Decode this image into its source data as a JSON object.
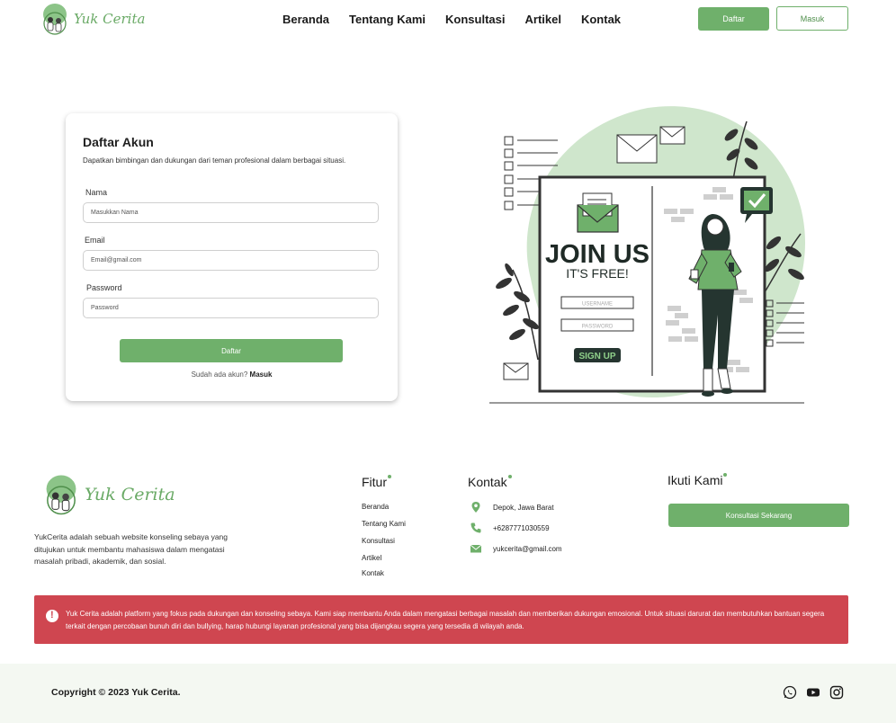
{
  "brand": {
    "name": "Yuk Cerita"
  },
  "nav": {
    "items": [
      "Beranda",
      "Tentang Kami",
      "Konsultasi",
      "Artikel",
      "Kontak"
    ],
    "daftar_label": "Daftar",
    "masuk_label": "Masuk"
  },
  "form": {
    "title": "Daftar Akun",
    "subtitle": "Dapatkan bimbingan dan dukungan dari teman profesional dalam berbagai situasi.",
    "fields": [
      {
        "label": "Nama",
        "placeholder": "Masukkan Nama"
      },
      {
        "label": "Email",
        "placeholder": "Email@gmail.com"
      },
      {
        "label": "Password",
        "placeholder": "Password"
      }
    ],
    "submit_label": "Daftar",
    "login_prompt": "Sudah ada akun?",
    "login_link": "Masuk"
  },
  "illustration": {
    "headline": "JOIN US",
    "subheadline": "IT'S FREE!",
    "username_label": "USERNAME",
    "password_label": "PASSWORD",
    "signup_label": "SIGN UP"
  },
  "footer": {
    "description": "YukCerita adalah sebuah website konseling sebaya yang ditujukan untuk membantu mahasiswa dalam mengatasi masalah pribadi, akademik, dan sosial.",
    "fitur_title": "Fitur",
    "fitur_links": [
      "Beranda",
      "Tentang Kami",
      "Konsultasi",
      "Artikel",
      "Kontak"
    ],
    "kontak_title": "Kontak",
    "location": "Depok, Jawa Barat",
    "phone": "+6287771030559",
    "email": "yukcerita@gmail.com",
    "ikuti_title": "Ikuti Kami",
    "cta_label": "Konsultasi Sekarang"
  },
  "alert": {
    "text": "Yuk Cerita adalah platform yang fokus pada dukungan dan konseling sebaya. Kami siap membantu Anda dalam mengatasi berbagai masalah dan memberikan dukungan emosional. Untuk situasi darurat dan membutuhkan bantuan segera terkait dengan percobaan bunuh diri dan bullying, harap hubungi layanan profesional yang bisa dijangkau segera yang tersedia di wilayah anda."
  },
  "bottom": {
    "copyright": "Copyright © 2023 Yuk Cerita.",
    "socials": [
      "whatsapp-icon",
      "youtube-icon",
      "instagram-icon"
    ]
  },
  "colors": {
    "accent": "#6fb06b",
    "alert": "#cf4650",
    "bottom_bg": "#f4f8f2",
    "illustration_blob": "#cfe6cc"
  }
}
